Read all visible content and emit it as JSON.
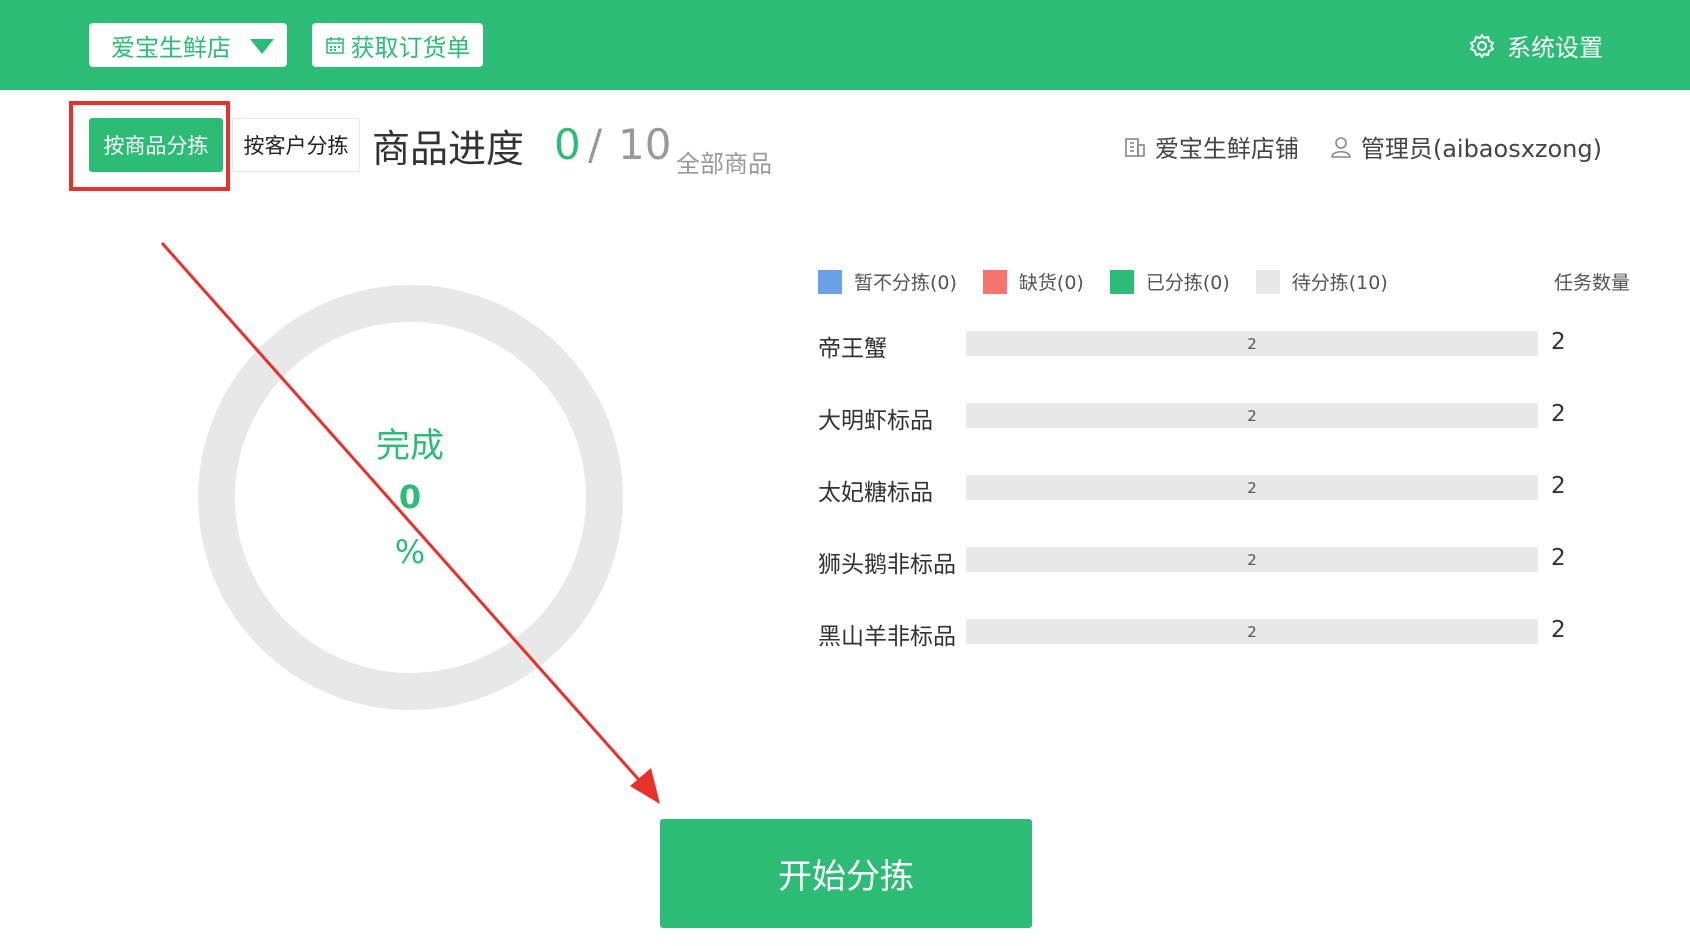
{
  "header": {
    "store_name": "爱宝生鲜店",
    "fetch_orders": "获取订货单",
    "settings": "系统设置"
  },
  "tabs": {
    "by_goods": "按商品分拣",
    "by_customer": "按客户分拣"
  },
  "progress": {
    "title": "商品进度",
    "done": "0",
    "separator": "/",
    "total": "10",
    "scope": "全部商品"
  },
  "shop": {
    "name": "爱宝生鲜店铺",
    "user": "管理员(aibaosxzong)"
  },
  "ring": {
    "label": "完成",
    "percent_value": "0",
    "percent_sign": "%",
    "completion": 0
  },
  "legend": {
    "items": [
      {
        "label": "暂不分拣(0)",
        "color": "#6aa1e8"
      },
      {
        "label": "缺货(0)",
        "color": "#f4746e"
      },
      {
        "label": "已分拣(0)",
        "color": "#2dbc76"
      },
      {
        "label": "待分拣(10)",
        "color": "#e8e8e8"
      }
    ],
    "task_header": "任务数量"
  },
  "goods": [
    {
      "name": "帝王蟹",
      "bar_value": "2",
      "count": "2"
    },
    {
      "name": "大明虾标品",
      "bar_value": "2",
      "count": "2"
    },
    {
      "name": "太妃糖标品",
      "bar_value": "2",
      "count": "2"
    },
    {
      "name": "狮头鹅非标品",
      "bar_value": "2",
      "count": "2"
    },
    {
      "name": "黑山羊非标品",
      "bar_value": "2",
      "count": "2"
    }
  ],
  "start_button": "开始分拣",
  "colors": {
    "brand": "#2dbc76",
    "annotation": "#e8302d"
  }
}
